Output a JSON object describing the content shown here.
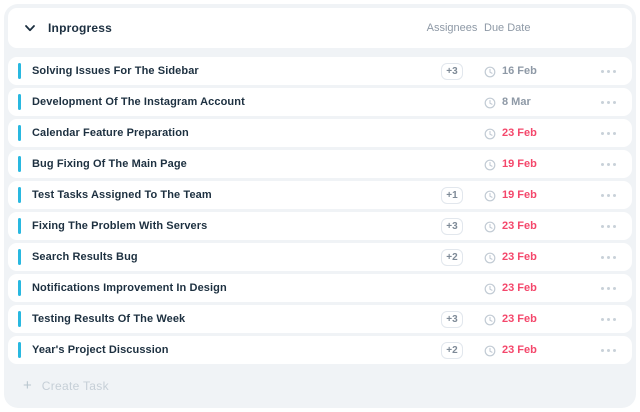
{
  "board": {
    "group": {
      "label": "Inprogress"
    },
    "columns": {
      "assignees": "Assignees",
      "due_date": "Due Date"
    },
    "tasks": [
      {
        "title": "Solving Issues For The Sidebar",
        "assignees_extra": "+3",
        "due": "16 Feb",
        "overdue": false
      },
      {
        "title": "Development Of The Instagram Account",
        "assignees_extra": null,
        "due": "8 Mar",
        "overdue": false
      },
      {
        "title": "Calendar Feature Preparation",
        "assignees_extra": null,
        "due": "23 Feb",
        "overdue": true
      },
      {
        "title": "Bug Fixing Of The Main Page",
        "assignees_extra": null,
        "due": "19 Feb",
        "overdue": true
      },
      {
        "title": "Test Tasks Assigned To The Team",
        "assignees_extra": "+1",
        "due": "19 Feb",
        "overdue": true
      },
      {
        "title": "Fixing The Problem With Servers",
        "assignees_extra": "+3",
        "due": "23 Feb",
        "overdue": true
      },
      {
        "title": "Search Results Bug",
        "assignees_extra": "+2",
        "due": "23 Feb",
        "overdue": true
      },
      {
        "title": "Notifications Improvement In Design",
        "assignees_extra": null,
        "due": "23 Feb",
        "overdue": true
      },
      {
        "title": "Testing Results Of The Week",
        "assignees_extra": "+3",
        "due": "23 Feb",
        "overdue": true
      },
      {
        "title": "Year's Project Discussion",
        "assignees_extra": "+2",
        "due": "23 Feb",
        "overdue": true
      }
    ],
    "footer": {
      "create_task_label": "Create Task",
      "plus_glyph": "+"
    },
    "icons": {
      "chevron": "chevron-down-icon",
      "clock": "clock-icon",
      "menu": "ellipsis-menu-icon",
      "plus": "plus-icon"
    },
    "colors": {
      "accent_bar": "#29b8e0",
      "overdue_date": "#f4476b",
      "normal_date": "#8e99a6",
      "panel_bg": "#f0f3f6",
      "title_text": "#1d3040"
    }
  }
}
